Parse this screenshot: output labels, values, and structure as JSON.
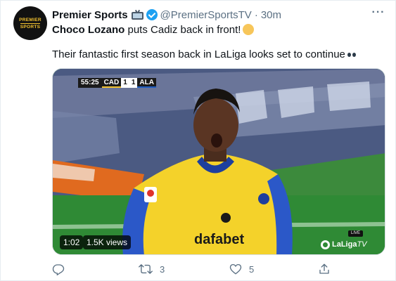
{
  "tweet": {
    "avatar": {
      "line1": "PREMIER",
      "line2": "SPORTS"
    },
    "author_name": "Premier Sports",
    "handle": "@PremierSportsTV",
    "separator": "·",
    "time": "30m",
    "more_label": "···",
    "text_bold": "Choco Lozano",
    "text_rest": " puts Cadiz back in front!",
    "text_line2": "Their fantastic first season back in LaLiga looks set to continue"
  },
  "media": {
    "scorebug": {
      "clock": "55:25",
      "home_team": "CAD",
      "home_score": "1",
      "away_score": "1",
      "away_team": "ALA"
    },
    "jersey_sponsor": "dafabet",
    "duration": "1:02",
    "views": "1.5K views",
    "live_label": "LIVE",
    "broadcaster_name": "LaLiga",
    "broadcaster_suffix": "TV"
  },
  "actions": {
    "reply_count": "",
    "retweet_count": "3",
    "like_count": "5",
    "share_count": ""
  },
  "colors": {
    "link_gray": "#5b7083",
    "verified_blue": "#1da1f2",
    "cadiz_yellow": "#f2c230",
    "pitch_green": "#3c8a3c"
  },
  "icons": [
    "tv-icon",
    "verified-badge-icon",
    "more-icon",
    "reply-icon",
    "retweet-icon",
    "like-icon",
    "share-icon"
  ]
}
